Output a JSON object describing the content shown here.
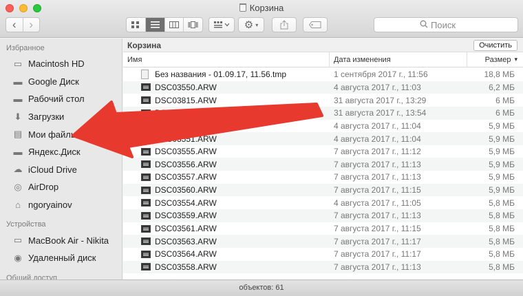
{
  "window": {
    "title": "Корзина",
    "trash_icon": "trash-icon"
  },
  "toolbar": {
    "back_icon": "‹",
    "forward_icon": "›",
    "view_icons": [
      "icon-view-icon",
      "list-view-icon",
      "column-view-icon",
      "coverflow-view-icon"
    ],
    "arrange_icon": "arrange-icon",
    "action_icon": "gear-icon",
    "share_icon": "share-icon",
    "tag_icon": "tag-icon"
  },
  "search": {
    "placeholder": "Поиск"
  },
  "sidebar": {
    "favorites_heading": "Избранное",
    "favorites": [
      {
        "label": "Macintosh HD",
        "icon": "disk-icon",
        "glyph": "▭"
      },
      {
        "label": "Google Диск",
        "icon": "folder-icon",
        "glyph": "▬"
      },
      {
        "label": "Рабочий стол",
        "icon": "folder-icon",
        "glyph": "▬"
      },
      {
        "label": "Загрузки",
        "icon": "downloads-icon",
        "glyph": "⬇"
      },
      {
        "label": "Мои файлы",
        "icon": "documents-icon",
        "glyph": "▤"
      },
      {
        "label": "Яндекс.Диск",
        "icon": "folder-icon",
        "glyph": "▬"
      },
      {
        "label": "iCloud Drive",
        "icon": "cloud-icon",
        "glyph": "☁"
      },
      {
        "label": "AirDrop",
        "icon": "airdrop-icon",
        "glyph": "◎"
      },
      {
        "label": "ngoryainov",
        "icon": "home-icon",
        "glyph": "⌂"
      }
    ],
    "devices_heading": "Устройства",
    "devices": [
      {
        "label": "MacBook Air - Nikita",
        "icon": "laptop-icon",
        "glyph": "▭"
      },
      {
        "label": "Удаленный диск",
        "icon": "remote-disc-icon",
        "glyph": "◉"
      }
    ],
    "shared_heading": "Общий доступ"
  },
  "main": {
    "location": "Корзина",
    "empty_button": "Очистить",
    "columns": {
      "name": "Имя",
      "date": "Дата изменения",
      "size": "Размер",
      "sort_indicator": "▾"
    },
    "files": [
      {
        "name": "Без названия - 01.09.17, 11.56.tmp",
        "date": "1 сентября 2017 г., 11:56",
        "size": "18,8 МБ",
        "kind": "doc"
      },
      {
        "name": "DSC03550.ARW",
        "date": "4 августа 2017 г., 11:03",
        "size": "6,2 МБ",
        "kind": "img"
      },
      {
        "name": "DSC03815.ARW",
        "date": "31 августа 2017 г., 13:29",
        "size": "6 МБ",
        "kind": "img"
      },
      {
        "name": "DSC03840.ARW",
        "date": "31 августа 2017 г., 13:54",
        "size": "6 МБ",
        "kind": "img"
      },
      {
        "name": "DSC03552.ARW",
        "date": "4 августа 2017 г., 11:04",
        "size": "5,9 МБ",
        "kind": "img"
      },
      {
        "name": "DSC03551.ARW",
        "date": "4 августа 2017 г., 11:04",
        "size": "5,9 МБ",
        "kind": "img"
      },
      {
        "name": "DSC03555.ARW",
        "date": "7 августа 2017 г., 11:12",
        "size": "5,9 МБ",
        "kind": "img"
      },
      {
        "name": "DSC03556.ARW",
        "date": "7 августа 2017 г., 11:13",
        "size": "5,9 МБ",
        "kind": "img"
      },
      {
        "name": "DSC03557.ARW",
        "date": "7 августа 2017 г., 11:13",
        "size": "5,9 МБ",
        "kind": "img"
      },
      {
        "name": "DSC03560.ARW",
        "date": "7 августа 2017 г., 11:15",
        "size": "5,9 МБ",
        "kind": "img"
      },
      {
        "name": "DSC03554.ARW",
        "date": "4 августа 2017 г., 11:05",
        "size": "5,8 МБ",
        "kind": "img"
      },
      {
        "name": "DSC03559.ARW",
        "date": "7 августа 2017 г., 11:13",
        "size": "5,8 МБ",
        "kind": "img"
      },
      {
        "name": "DSC03561.ARW",
        "date": "7 августа 2017 г., 11:15",
        "size": "5,8 МБ",
        "kind": "img"
      },
      {
        "name": "DSC03563.ARW",
        "date": "7 августа 2017 г., 11:17",
        "size": "5,8 МБ",
        "kind": "img"
      },
      {
        "name": "DSC03564.ARW",
        "date": "7 августа 2017 г., 11:17",
        "size": "5,8 МБ",
        "kind": "img"
      },
      {
        "name": "DSC03558.ARW",
        "date": "7 августа 2017 г., 11:13",
        "size": "5,8 МБ",
        "kind": "img"
      }
    ]
  },
  "status": {
    "text": "объектов: 61"
  },
  "annotation": {
    "arrow_color": "#e8392f"
  }
}
